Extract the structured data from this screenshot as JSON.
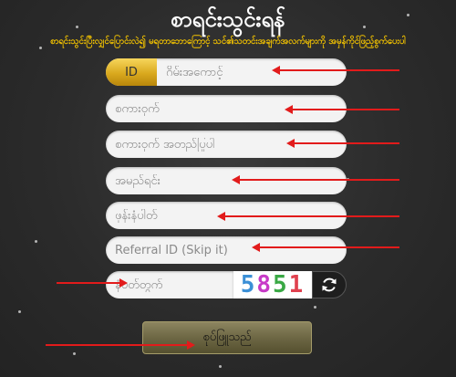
{
  "header": {
    "title": "စာရင်းသွင်းရန်",
    "subtitle": "စာရင်းသွင်းပြီးလျှင်ပြောင်းလဲ၍ မရတာဘောကြောင့် သင်၏သတင်းအချက်အလက်များကို အမှန်ကိုင်ဖြည့်စွက်ပေးပါ"
  },
  "form": {
    "id_badge": "ID",
    "username_placeholder": "ဂိမ်းအကောင့်",
    "password_placeholder": "စကားဝှက်",
    "confirm_password_placeholder": "စကားဝှက် အတည်ပြုပါ",
    "name_placeholder": "အမည်ရင်း",
    "phone_placeholder": "ဖုန်းနံပါတ်",
    "referral_placeholder": "Referral ID (Skip it)",
    "captcha_placeholder": "နံပတ်တွက်",
    "captcha_code": [
      "5",
      "8",
      "5",
      "1"
    ],
    "submit_label": "စုပ်ဖြူသည်"
  },
  "colors": {
    "accent_gold": "#f2c200",
    "arrow_red": "#e21b1b",
    "background": "#2b2b2b"
  }
}
